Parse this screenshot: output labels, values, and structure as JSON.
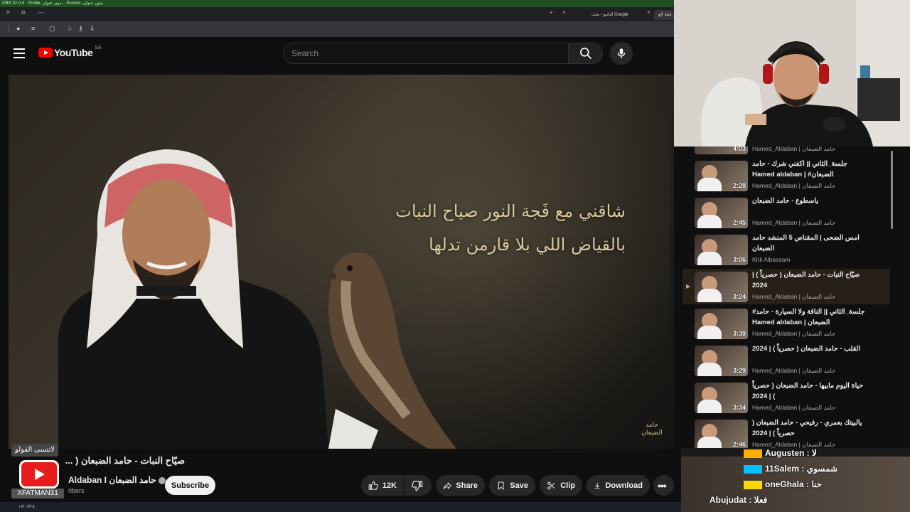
{
  "obs": {
    "title": "OBS 32.0.4 - Profile: بدون عنوان - Scenes: بدون عنوان"
  },
  "browser": {
    "tabs": [
      {
        "label": "البانيو - بحث Google"
      },
      {
        "label": "فيلة الع"
      }
    ],
    "new_tab": "+",
    "close": "×"
  },
  "youtube": {
    "logo_text": "YouTube",
    "country_code": "SA",
    "search_placeholder": "Search"
  },
  "video": {
    "lyric_line1": "شاقني مع فَجة النور صياح النبات",
    "lyric_line2": "بالقياض اللي بلا قارمن تدلها",
    "signature": "حامد الضبعان",
    "title": "صيّاح النبات - حامد الضبعان ( ...",
    "channel": "Aldaban I حامد الضبعان",
    "subscribers": "ribers",
    "subscribe_label": "Subscribe",
    "likes": "12K",
    "share_label": "Share",
    "save_label": "Save",
    "clip_label": "Clip",
    "download_label": "Download"
  },
  "overlay": {
    "top_text": "لاتنسى الفولو",
    "name": "XFATMAN31"
  },
  "taskbar": {
    "date": "١٧/٠٧/٢٥"
  },
  "playlist": {
    "partial_duration": "4:03",
    "partial_channel": "Hamed_Aldaban | حامد الضبعان",
    "items": [
      {
        "title": "جلسة_الثاني || اكفني شرك - حامد الضبعان# | Hamed aldaban",
        "duration": "2:28",
        "channel": "Hamed_Aldaban | حامد الضبعان",
        "current": false
      },
      {
        "title": "ياسطوع - حامد الضبعان",
        "duration": "2:45",
        "channel": "Hamed_Aldaban | حامد الضبعان",
        "current": false
      },
      {
        "title": "امس الضحى | المقناص 5 المنشد حامد الضبعان",
        "duration": "3:06",
        "channel": "Khli Albassam",
        "current": false
      },
      {
        "title": "صيّاح النبات - حامد الضبعان ( حصرياً ) | 2024",
        "duration": "3:24",
        "channel": "Hamed_Aldaban | حامد الضبعان",
        "current": true
      },
      {
        "title": "جلسة_الثاني || الناقة ولا السيارة - حامد# الضبعان | Hamed aldaban",
        "duration": "3:39",
        "channel": "Hamed_Aldaban | حامد الضبعان",
        "current": false
      },
      {
        "title": "القلب - حامد الضبعان ( حصرياً ) | 2024",
        "duration": "3:29",
        "channel": "Hamed_Aldaban | حامد الضبعان",
        "current": false
      },
      {
        "title": "حياة اليوم مابيها - حامد الضبعان ( حصرياً ) | 2024",
        "duration": "3:34",
        "channel": "Hamed_Aldaban | حامد الضبعان",
        "current": false
      },
      {
        "title": "يالبيتك بعمري - رفيحي - حامد الضبعان ( حصرياً ) | 2024",
        "duration": "2:46",
        "channel": "Hamed_Aldaban | حامد الضبعان",
        "current": false
      }
    ]
  },
  "chat": {
    "messages": [
      {
        "user": "Augusten",
        "text": "لا",
        "badge_color": "#ffb000"
      },
      {
        "user": "11Salem",
        "text": "شمسوي",
        "badge_color": "#00c0ff"
      },
      {
        "user": "oneGhala",
        "text": "حنا",
        "badge_color": "#ffd700"
      },
      {
        "user": "Abujudat",
        "text": "فعلا",
        "badge_color": "#888888"
      }
    ]
  }
}
